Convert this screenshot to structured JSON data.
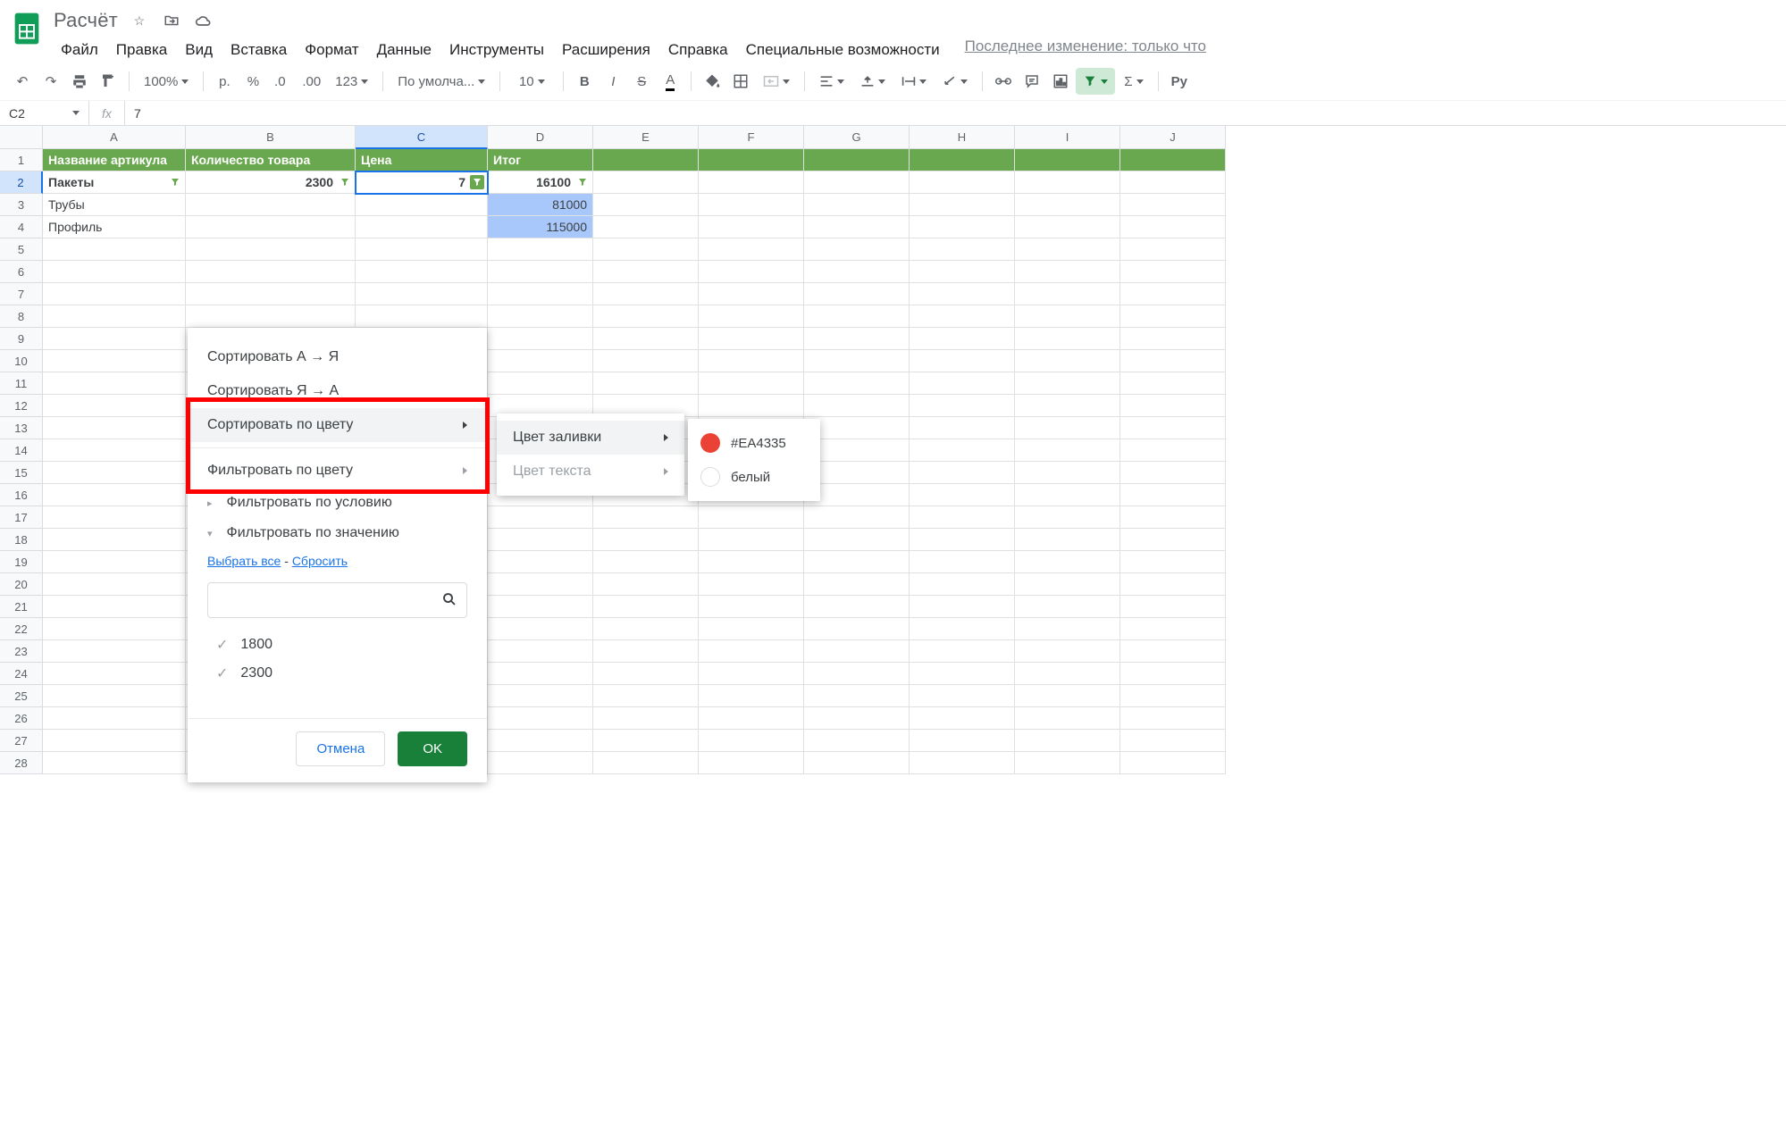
{
  "doc": {
    "title": "Расчёт"
  },
  "menu": {
    "items": [
      "Файл",
      "Правка",
      "Вид",
      "Вставка",
      "Формат",
      "Данные",
      "Инструменты",
      "Расширения",
      "Справка",
      "Специальные возможности"
    ],
    "last_edit": "Последнее изменение: только что"
  },
  "toolbar": {
    "zoom": "100%",
    "currency": "р.",
    "font": "По умолча...",
    "font_size": "10"
  },
  "formula": {
    "name_box": "C2",
    "value": "7"
  },
  "columns": [
    "A",
    "B",
    "C",
    "D",
    "E",
    "F",
    "G",
    "H",
    "I",
    "J"
  ],
  "sheet": {
    "headers": [
      "Название артикула",
      "Количество товара",
      "Цена",
      "Итог"
    ],
    "rows": [
      {
        "a": "Пакеты",
        "b": "2300",
        "c": "7",
        "d": "16100"
      },
      {
        "a": "Трубы",
        "b": "",
        "c": "",
        "d": "81000"
      },
      {
        "a": "Профиль",
        "b": "",
        "c": "",
        "d": "115000"
      }
    ]
  },
  "filter_popup": {
    "sort_az": "Сортировать А → Я",
    "sort_za": "Сортировать Я → А",
    "sort_color": "Сортировать по цвету",
    "filter_color": "Фильтровать по цвету",
    "filter_condition": "Фильтровать по условию",
    "filter_value": "Фильтровать по значению",
    "select_all": "Выбрать все",
    "reset": "Сбросить",
    "values": [
      "1800",
      "2300"
    ],
    "cancel": "Отмена",
    "ok": "OK"
  },
  "submenu": {
    "fill_color": "Цвет заливки",
    "text_color": "Цвет текста"
  },
  "submenu2": {
    "color_hex": "#EA4335",
    "white": "белый"
  }
}
